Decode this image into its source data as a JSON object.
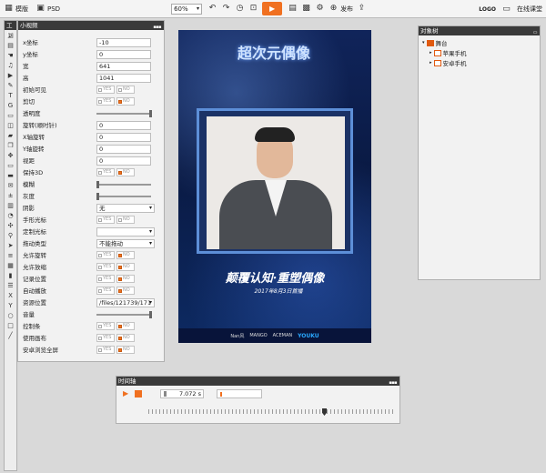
{
  "topbar": {
    "template_label": "模版",
    "psd_label": "PSD",
    "zoom_value": "60%",
    "publish_label": "发布",
    "logo_label": "LOGO",
    "classroom_label": "在线课堂"
  },
  "toolbox": {
    "title": "工具",
    "icons": [
      "image-icon",
      "text-block-icon",
      "hand-icon",
      "music-icon",
      "video-icon",
      "brush-icon",
      "text-icon",
      "gif-icon",
      "shape-icon",
      "layer-icon",
      "folder-icon",
      "copy-icon",
      "move-icon",
      "monitor-icon",
      "desktop-icon",
      "mail-icon",
      "number-icon",
      "chart-icon",
      "timer-icon",
      "puzzle-icon",
      "pin-icon",
      "cursor-icon",
      "align-icon",
      "grid-icon",
      "book-icon",
      "list-icon",
      "text-x-icon",
      "text-y-icon",
      "circle-icon",
      "square-icon",
      "line-icon"
    ]
  },
  "props": {
    "title": "小视频",
    "yes_label": "YES",
    "no_label": "NO",
    "x_label": "x坐标",
    "x_value": "-10",
    "y_label": "y坐标",
    "y_value": "0",
    "w_label": "宽",
    "w_value": "641",
    "h_label": "高",
    "h_value": "1041",
    "initvis_label": "初始可见",
    "clip_label": "剪切",
    "opacity_label": "透明度",
    "rotate_label": "旋转(顺时针)",
    "rotate_value": "0",
    "xrot_label": "X轴旋转",
    "xrot_value": "0",
    "yrot_label": "Y轴旋转",
    "yrot_value": "0",
    "viewdist_label": "视距",
    "viewdist_value": "0",
    "keep3d_label": "保持3D",
    "blur_label": "模糊",
    "gray_label": "灰度",
    "shadow_label": "阴影",
    "shadow_value": "无",
    "handcursor_label": "手形光标",
    "customcursor_label": "定制光标",
    "dragtype_label": "拖动类型",
    "dragtype_value": "不能拖动",
    "allowrotate_label": "允许旋转",
    "allowzoom_label": "允许放缩",
    "recordpos_label": "记录位置",
    "autoplay_label": "自动播放",
    "resource_label": "资源位置",
    "resource_value": "/files/121739/171",
    "volume_label": "音量",
    "controls_label": "控制条",
    "useposter_label": "使用画布",
    "androidfs_label": "安卓浏览全屏"
  },
  "stage": {
    "show_title": "超次元偶像",
    "slogan": "颠覆认知·重塑偶像",
    "date_text": "2017年8月3日首播",
    "sponsors": [
      "Nan风",
      "MANGO",
      "ACEMAN",
      "YOUKU"
    ]
  },
  "tree": {
    "title": "对象树",
    "root": "舞台",
    "children": [
      "苹果手机",
      "安卓手机"
    ]
  },
  "timeline": {
    "title": "时间轴",
    "time_value": "7.072 s"
  }
}
